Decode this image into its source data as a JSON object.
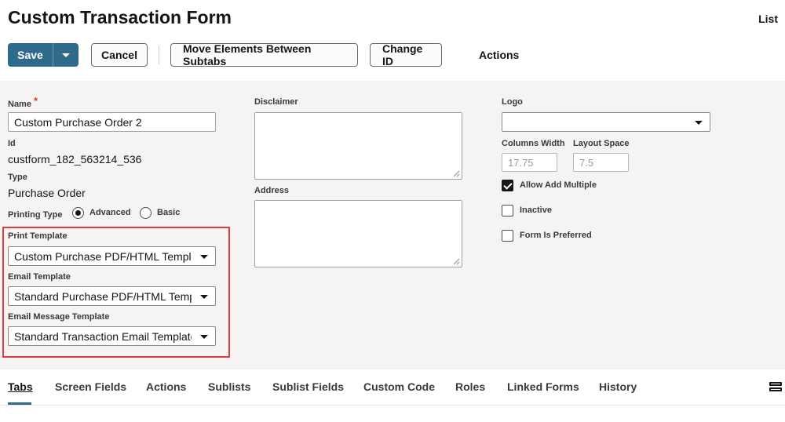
{
  "header": {
    "title": "Custom Transaction Form",
    "list_link": "List"
  },
  "toolbar": {
    "save_label": "Save",
    "cancel_label": "Cancel",
    "move_label": "Move Elements Between Subtabs",
    "change_id_label": "Change ID",
    "actions_label": "Actions"
  },
  "form": {
    "name_label": "Name",
    "name_required": "*",
    "name_value": "Custom Purchase Order 2",
    "id_label": "Id",
    "id_value": "custform_182_563214_536",
    "type_label": "Type",
    "type_value": "Purchase Order",
    "printing_type_label": "Printing Type",
    "printing_type_options": [
      "Advanced",
      "Basic"
    ],
    "printing_type_selected": "Advanced",
    "print_template_label": "Print Template",
    "print_template_value": "Custom Purchase PDF/HTML Template",
    "email_template_label": "Email Template",
    "email_template_value": "Standard Purchase PDF/HTML Template",
    "email_message_template_label": "Email Message Template",
    "email_message_template_value": "Standard Transaction Email Template",
    "disclaimer_label": "Disclaimer",
    "address_label": "Address",
    "logo_label": "Logo",
    "logo_value": "",
    "columns_width_label": "Columns Width",
    "columns_width_placeholder": "17.75",
    "layout_space_label": "Layout Space",
    "layout_space_placeholder": "7.5",
    "allow_add_multiple_label": "Allow Add Multiple",
    "allow_add_multiple_checked": true,
    "inactive_label": "Inactive",
    "inactive_checked": false,
    "form_is_preferred_label": "Form Is Preferred",
    "form_is_preferred_checked": false
  },
  "tabs": {
    "items": [
      {
        "label": "Tabs",
        "active": true
      },
      {
        "label": "Screen Fields"
      },
      {
        "label": "Actions"
      },
      {
        "label": "Sublists"
      },
      {
        "label": "Sublist Fields"
      },
      {
        "label": "Custom Code"
      },
      {
        "label": "Roles"
      },
      {
        "label": "Linked Forms"
      },
      {
        "label": "History"
      }
    ]
  },
  "icons": {
    "save_menu": "chevron-down-icon",
    "resize": "resize-handle-icon",
    "tabs_menu": "hamburger-menu-icon"
  },
  "colors": {
    "primary": "#2e6b8a",
    "highlight": "#e0393e",
    "form_background": "#f5f4f2"
  }
}
